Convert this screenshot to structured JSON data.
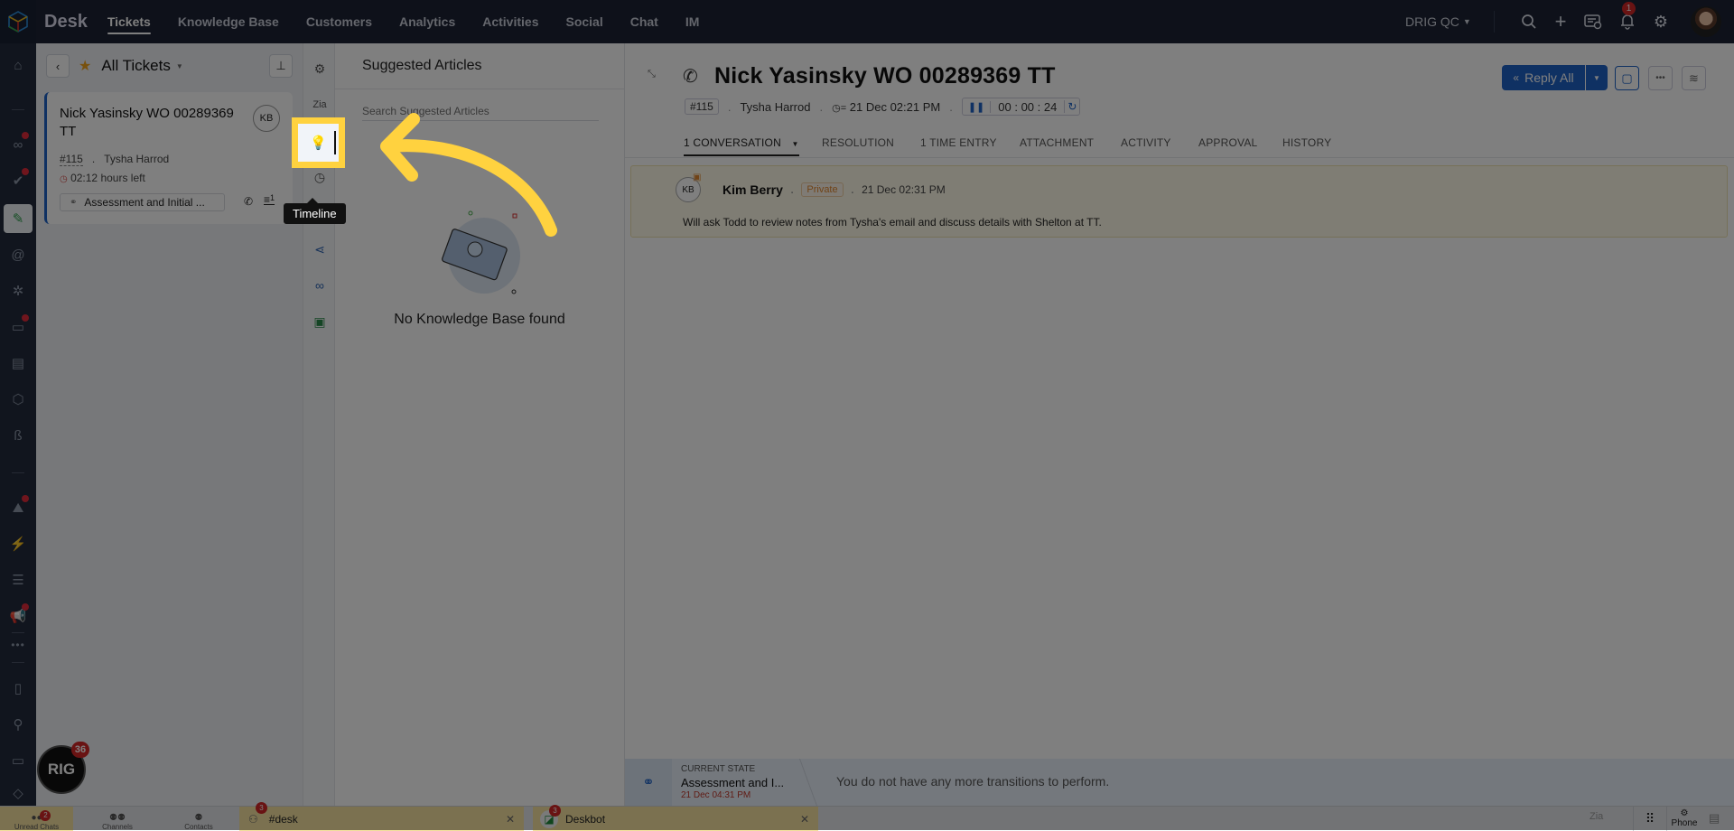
{
  "topbar": {
    "brand": "Desk",
    "nav": [
      "Tickets",
      "Knowledge Base",
      "Customers",
      "Analytics",
      "Activities",
      "Social",
      "Chat",
      "IM"
    ],
    "active_nav": "Tickets",
    "org": "DRIG QC",
    "notification_count": "1",
    "icons": [
      "search-icon",
      "plus-icon",
      "ticket-alert-icon",
      "bell-icon",
      "gear-icon",
      "user-avatar"
    ]
  },
  "rail": {
    "icons": [
      "home-icon",
      "link-icon",
      "check-icon",
      "tickets-icon",
      "at-icon",
      "network-icon",
      "folder-chart-icon",
      "documents-icon",
      "cubes-icon",
      "badge-icon",
      "mountain-icon",
      "bolt-icon",
      "certificate-icon",
      "megaphone-icon",
      "more-icon",
      "notebook-icon",
      "search-zoom-icon",
      "wallet-icon",
      "tag-icon"
    ],
    "more_label": "•••"
  },
  "list": {
    "view_title": "All Tickets",
    "card": {
      "subject": "Nick Yasinsky WO 00289369 TT",
      "initials": "KB",
      "number": "#115",
      "contact": "Tysha Harrod",
      "due": "02:12 hours left",
      "status": "Assessment and Initial ...",
      "thread_count": "1"
    }
  },
  "side_icons": [
    "properties-icon",
    "zia-icon",
    "suggested-articles-icon",
    "timeline-icon",
    "share-icon",
    "link-icon",
    "checklist-icon"
  ],
  "tooltip": "Timeline",
  "suggested": {
    "title": "Suggested Articles",
    "search_placeholder": "Search Suggested Articles",
    "empty_text": "No Knowledge Base found"
  },
  "ticket": {
    "title": "Nick Yasinsky WO 00289369 TT",
    "number": "#115",
    "contact": "Tysha Harrod",
    "due_date": "21 Dec 02:21 PM",
    "timer": "00 : 00 : 24",
    "reply_label": "Reply All",
    "tabs": [
      "1 CONVERSATION",
      "RESOLUTION",
      "1 TIME ENTRY",
      "ATTACHMENT",
      "ACTIVITY",
      "APPROVAL",
      "HISTORY"
    ],
    "active_tab": "1 CONVERSATION"
  },
  "note": {
    "initials": "KB",
    "author": "Kim Berry",
    "visibility": "Private",
    "time": "21 Dec 02:31 PM",
    "body": "Will ask Todd to review notes from Tysha's email and discuss details with Shelton at TT."
  },
  "state": {
    "label": "CURRENT STATE",
    "value": "Assessment and I...",
    "time": "21 Dec 04:31 PM",
    "message": "You do not have any more transitions to perform."
  },
  "chatbar": {
    "unread_label": "Unread Chats",
    "unread_count": "2",
    "channels_label": "Channels",
    "contacts_label": "Contacts",
    "bot_badge": "36",
    "bot_logo_text": "RIG",
    "tabs": [
      {
        "name": "#desk",
        "count": "3"
      },
      {
        "name": "Deskbot",
        "count": "3"
      }
    ],
    "phone_label": "Phone"
  },
  "colors": {
    "accent": "#1f63c6",
    "highlight": "#ffd23f",
    "topbar": "#1c2234",
    "badge": "#d32626",
    "private": "#e0872f"
  }
}
